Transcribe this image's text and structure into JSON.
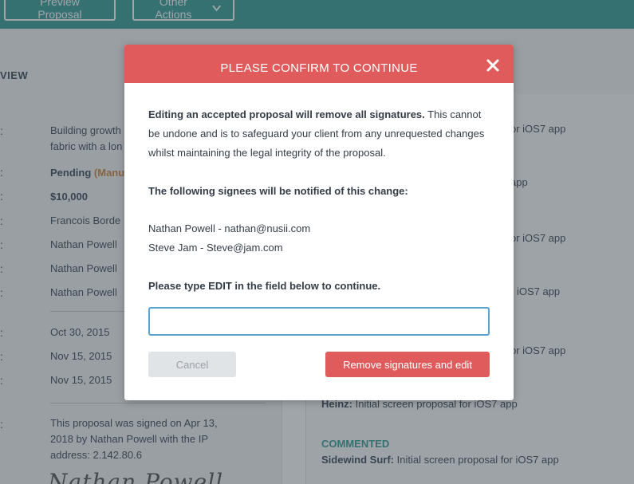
{
  "toolbar": {
    "preview_label": "Preview Proposal",
    "other_actions_label": "Other Actions"
  },
  "subheader": {
    "view_tab": "VIEW"
  },
  "details": {
    "colon": ":",
    "description": "Building growth",
    "description_line2": "fabric with a lon",
    "status": "Pending",
    "status_manual": "(Manu",
    "amount": "$10,000",
    "name1": "Francois Borde",
    "name2": "Nathan Powell",
    "name3": "Nathan Powell",
    "name4": "Nathan Powell",
    "date1": "Oct 30, 2015",
    "date2": "Nov 15, 2015",
    "date3": "Nov 15, 2015",
    "signed_line1": "This proposal was signed on Apr 13,",
    "signed_line2": "2018 by Nathan Powell with the IP",
    "signed_line3": "address: 2.142.80.6",
    "signature": "Nathan Powell"
  },
  "activity": {
    "items": [
      {
        "text": "or iOS7 app"
      },
      {
        "text": "app"
      },
      {
        "text": "or iOS7 app"
      },
      {
        "text": "r iOS7 app"
      },
      {
        "text": "or iOS7 app"
      }
    ],
    "heinz_author": "Heinz:",
    "heinz_text": "Initial screen proposal for iOS7 app",
    "commented_label": "COMMENTED",
    "sidewind_author": "Sidewind Surf:",
    "sidewind_text": "Initial screen proposal for iOS7 app"
  },
  "modal": {
    "title": "PLEASE CONFIRM TO CONTINUE",
    "warning_bold": "Editing an accepted proposal will remove all signatures.",
    "warning_rest": " This cannot be undone and is to safeguard your client from any unrequested changes whilst maintaining the legal integrity of the proposal.",
    "signees_heading": "The following signees will be notified of this change:",
    "signees": [
      "Nathan Powell - nathan@nusii.com",
      "Steve Jam - Steve@jam.com"
    ],
    "instruction": "Please type EDIT in the field below to continue.",
    "input_value": "",
    "input_placeholder": "",
    "cancel_label": "Cancel",
    "confirm_label": "Remove signatures and edit"
  },
  "colors": {
    "header_teal": "#3fa19a",
    "modal_red": "#e05c5c",
    "input_border": "#5aa0d0",
    "manual_orange": "#d08a45"
  }
}
